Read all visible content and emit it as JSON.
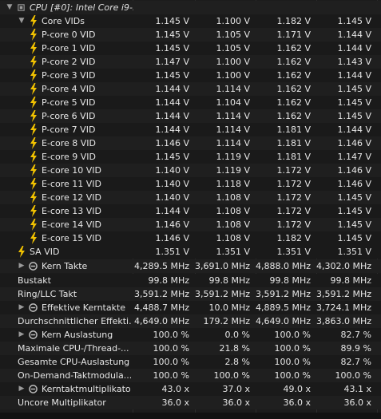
{
  "header": {
    "title": "CPU [#0]: Intel Core i9-..."
  },
  "group_core_vids": {
    "label": "Core VIDs",
    "values": [
      "1.145 V",
      "1.100 V",
      "1.182 V",
      "1.145 V"
    ]
  },
  "vid_rows": [
    {
      "label": "P-core 0 VID",
      "values": [
        "1.145 V",
        "1.105 V",
        "1.171 V",
        "1.144 V"
      ]
    },
    {
      "label": "P-core 1 VID",
      "values": [
        "1.145 V",
        "1.105 V",
        "1.162 V",
        "1.144 V"
      ]
    },
    {
      "label": "P-core 2 VID",
      "values": [
        "1.147 V",
        "1.100 V",
        "1.162 V",
        "1.143 V"
      ]
    },
    {
      "label": "P-core 3 VID",
      "values": [
        "1.145 V",
        "1.100 V",
        "1.162 V",
        "1.144 V"
      ]
    },
    {
      "label": "P-core 4 VID",
      "values": [
        "1.144 V",
        "1.114 V",
        "1.162 V",
        "1.145 V"
      ]
    },
    {
      "label": "P-core 5 VID",
      "values": [
        "1.144 V",
        "1.104 V",
        "1.162 V",
        "1.145 V"
      ]
    },
    {
      "label": "P-core 6 VID",
      "values": [
        "1.144 V",
        "1.114 V",
        "1.162 V",
        "1.145 V"
      ]
    },
    {
      "label": "P-core 7 VID",
      "values": [
        "1.144 V",
        "1.114 V",
        "1.181 V",
        "1.144 V"
      ]
    },
    {
      "label": "E-core 8 VID",
      "values": [
        "1.146 V",
        "1.114 V",
        "1.181 V",
        "1.146 V"
      ]
    },
    {
      "label": "E-core 9 VID",
      "values": [
        "1.145 V",
        "1.119 V",
        "1.181 V",
        "1.147 V"
      ]
    },
    {
      "label": "E-core 10 VID",
      "values": [
        "1.140 V",
        "1.119 V",
        "1.172 V",
        "1.146 V"
      ]
    },
    {
      "label": "E-core 11 VID",
      "values": [
        "1.140 V",
        "1.118 V",
        "1.172 V",
        "1.146 V"
      ]
    },
    {
      "label": "E-core 12 VID",
      "values": [
        "1.140 V",
        "1.108 V",
        "1.172 V",
        "1.145 V"
      ]
    },
    {
      "label": "E-core 13 VID",
      "values": [
        "1.144 V",
        "1.108 V",
        "1.172 V",
        "1.145 V"
      ]
    },
    {
      "label": "E-core 14 VID",
      "values": [
        "1.146 V",
        "1.108 V",
        "1.172 V",
        "1.145 V"
      ]
    },
    {
      "label": "E-core 15 VID",
      "values": [
        "1.146 V",
        "1.108 V",
        "1.182 V",
        "1.145 V"
      ]
    }
  ],
  "sa_vid": {
    "label": "SA VID",
    "values": [
      "1.351 V",
      "1.351 V",
      "1.351 V",
      "1.351 V"
    ]
  },
  "kern_takte": {
    "label": "Kern Takte",
    "values": [
      "4,289.5 MHz",
      "3,691.0 MHz",
      "4,888.0 MHz",
      "4,302.0 MHz"
    ]
  },
  "bustakt": {
    "label": "Bustakt",
    "values": [
      "99.8 MHz",
      "99.8 MHz",
      "99.8 MHz",
      "99.8 MHz"
    ]
  },
  "ring_llc": {
    "label": "Ring/LLC Takt",
    "values": [
      "3,591.2 MHz",
      "3,591.2 MHz",
      "3,591.2 MHz",
      "3,591.2 MHz"
    ]
  },
  "eff_kerntakte": {
    "label": "Effektive Kerntakte",
    "values": [
      "4,488.7 MHz",
      "10.0 MHz",
      "4,889.5 MHz",
      "3,724.1 MHz"
    ]
  },
  "durchschn_eff": {
    "label": "Durchschnittlicher Effekti...",
    "values": [
      "4,649.0 MHz",
      "179.2 MHz",
      "4,649.0 MHz",
      "3,863.0 MHz"
    ]
  },
  "kern_auslastung": {
    "label": "Kern Auslastung",
    "values": [
      "100.0 %",
      "0.0 %",
      "100.0 %",
      "82.7 %"
    ]
  },
  "max_cpu_thread": {
    "label": "Maximale CPU-/Thread-...",
    "values": [
      "100.0 %",
      "21.8 %",
      "100.0 %",
      "89.9 %"
    ]
  },
  "gesamt_cpu": {
    "label": "Gesamte CPU-Auslastung",
    "values": [
      "100.0 %",
      "2.8 %",
      "100.0 %",
      "82.7 %"
    ]
  },
  "on_demand": {
    "label": "On-Demand-Taktmodula...",
    "values": [
      "100.0 %",
      "100.0 %",
      "100.0 %",
      "100.0 %"
    ]
  },
  "kerntakt_mult": {
    "label": "Kerntaktmultiplikatoren",
    "values": [
      "43.0 x",
      "37.0 x",
      "49.0 x",
      "43.1 x"
    ]
  },
  "uncore_mult": {
    "label": "Uncore Multiplikator",
    "values": [
      "36.0 x",
      "36.0 x",
      "36.0 x",
      "36.0 x"
    ]
  },
  "icons": {
    "bolt": "lightning-bolt-icon",
    "clock": "clock-ring-icon",
    "expand": "chevron-right-icon",
    "collapse": "chevron-down-icon"
  },
  "colors": {
    "bolt": "#f2c200",
    "text": "#e6e6e6",
    "bg": "#1b1b1b"
  }
}
